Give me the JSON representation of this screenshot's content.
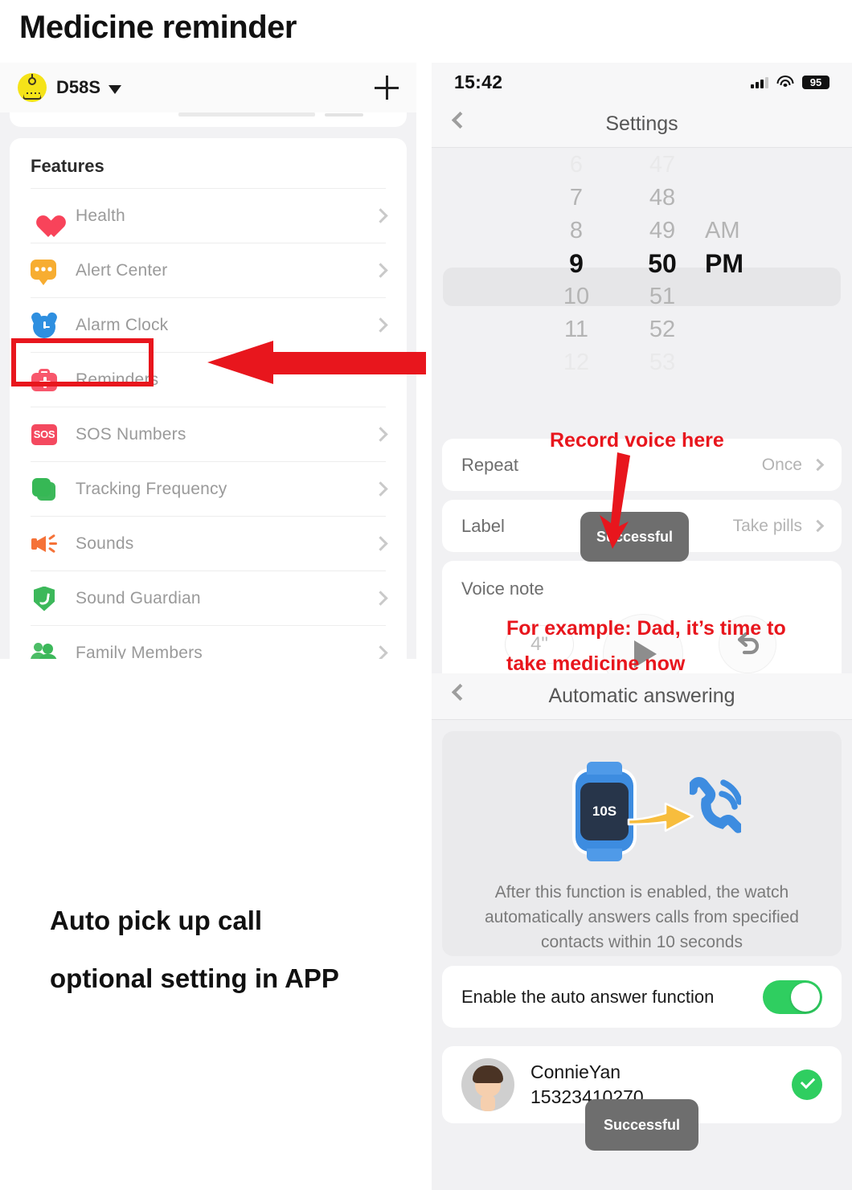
{
  "page": {
    "title": "Medicine reminder",
    "caption_line1": "Auto pick up call",
    "caption_line2": "optional setting in APP"
  },
  "left_panel": {
    "device_name": "D58S",
    "add_button_label": "+",
    "section_title": "Features",
    "items": [
      {
        "label": "Health",
        "icon": "heart-icon",
        "color": "#f8435a"
      },
      {
        "label": "Alert Center",
        "icon": "speech-bubble-icon",
        "color": "#f7ad31"
      },
      {
        "label": "Alarm Clock",
        "icon": "alarm-clock-icon",
        "color": "#2e8fe0"
      },
      {
        "label": "Reminders",
        "icon": "first-aid-kit-icon",
        "color": "#f8576c"
      },
      {
        "label": "SOS Numbers",
        "icon": "sos-icon",
        "color": "#f4495f",
        "icon_text": "SOS"
      },
      {
        "label": "Tracking Frequency",
        "icon": "layers-icon",
        "color": "#3cb85a"
      },
      {
        "label": "Sounds",
        "icon": "speaker-icon",
        "color": "#f57238"
      },
      {
        "label": "Sound Guardian",
        "icon": "shield-phone-icon",
        "color": "#3cb85a"
      },
      {
        "label": "Family Members",
        "icon": "people-icon",
        "color": "#3cb85a"
      }
    ],
    "highlighted_item": "Reminders"
  },
  "settings_screen": {
    "status_bar": {
      "time": "15:42",
      "battery": "95"
    },
    "nav_title": "Settings",
    "time_picker": {
      "hours": [
        "6",
        "7",
        "8",
        "9",
        "10",
        "11",
        "12"
      ],
      "minutes": [
        "47",
        "48",
        "49",
        "50",
        "51",
        "52",
        "53"
      ],
      "meridiem": [
        "AM",
        "PM"
      ],
      "selected_hour": "9",
      "selected_minute": "50",
      "selected_meridiem": "PM"
    },
    "rows": [
      {
        "label": "Repeat",
        "value": "Once"
      },
      {
        "label": "Label",
        "value": "Take pills"
      }
    ],
    "voice_note": {
      "label": "Voice note",
      "duration": "4\"",
      "play_icon": "play-icon",
      "redo_icon": "undo-arrow-icon"
    },
    "toast": "Successful",
    "annotations": {
      "record_here": "Record voice here",
      "example_line1": "For example: Dad, it’s time to",
      "example_line2": "take medicine now"
    }
  },
  "auto_answer_screen": {
    "nav_title": "Automatic answering",
    "illustration": {
      "watch_text": "10S",
      "watch_icon": "smart-watch-icon",
      "arrow_icon": "yellow-arrow-icon",
      "phone_icon": "ringing-phone-icon"
    },
    "description": "After this function is enabled, the watch automatically answers calls from specified contacts within 10 seconds",
    "toggle": {
      "label": "Enable the auto answer function",
      "state": "on",
      "color": "#2fce60"
    },
    "contact": {
      "name": "ConnieYan",
      "phone": "15323410270",
      "selected": true
    },
    "toast": "Successful"
  },
  "colors": {
    "annotation_red": "#e8161d",
    "toast_gray": "#6e6e6e",
    "accent_green": "#2fce60"
  }
}
